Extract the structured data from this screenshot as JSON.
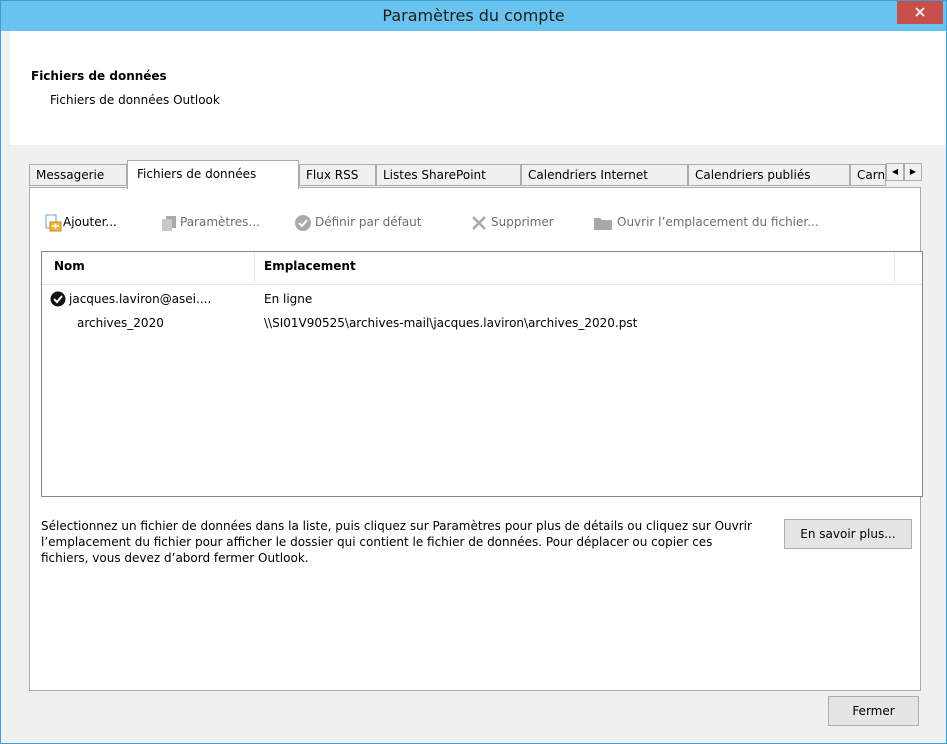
{
  "window": {
    "title": "Paramètres du compte",
    "close_icon": "close-icon"
  },
  "header": {
    "title": "Fichiers de données",
    "subtitle": "Fichiers de données Outlook"
  },
  "tabs": [
    {
      "label": "Messagerie"
    },
    {
      "label": "Fichiers de données"
    },
    {
      "label": "Flux RSS"
    },
    {
      "label": "Listes SharePoint"
    },
    {
      "label": "Calendriers Internet"
    },
    {
      "label": "Calendriers publiés"
    },
    {
      "label": "Carnets d'adresses"
    }
  ],
  "toolbar": {
    "add": "Ajouter...",
    "settings": "Paramètres...",
    "default": "Définir par défaut",
    "delete": "Supprimer",
    "open_location": "Ouvrir l’emplacement du fichier..."
  },
  "list": {
    "columns": [
      "Nom",
      "Emplacement"
    ],
    "rows": [
      {
        "name": "jacques.laviron@asei....",
        "location": "En ligne",
        "is_default": true
      },
      {
        "name": "archives_2020",
        "location": "\\\\SI01V90525\\archives-mail\\jacques.laviron\\archives_2020.pst",
        "is_default": false
      }
    ]
  },
  "description": "Sélectionnez un fichier de données dans la liste, puis cliquez sur Paramètres pour plus de détails ou cliquez sur Ouvrir l’emplacement du fichier pour afficher le dossier qui contient le fichier de données. Pour déplacer ou copier ces fichiers, vous devez d’abord fermer Outlook.",
  "buttons": {
    "learn_more": "En savoir plus...",
    "close": "Fermer"
  },
  "colors": {
    "titlebar": "#6ac3ef",
    "close_button": "#c7504c",
    "disabled_text": "#6d6d6d"
  }
}
